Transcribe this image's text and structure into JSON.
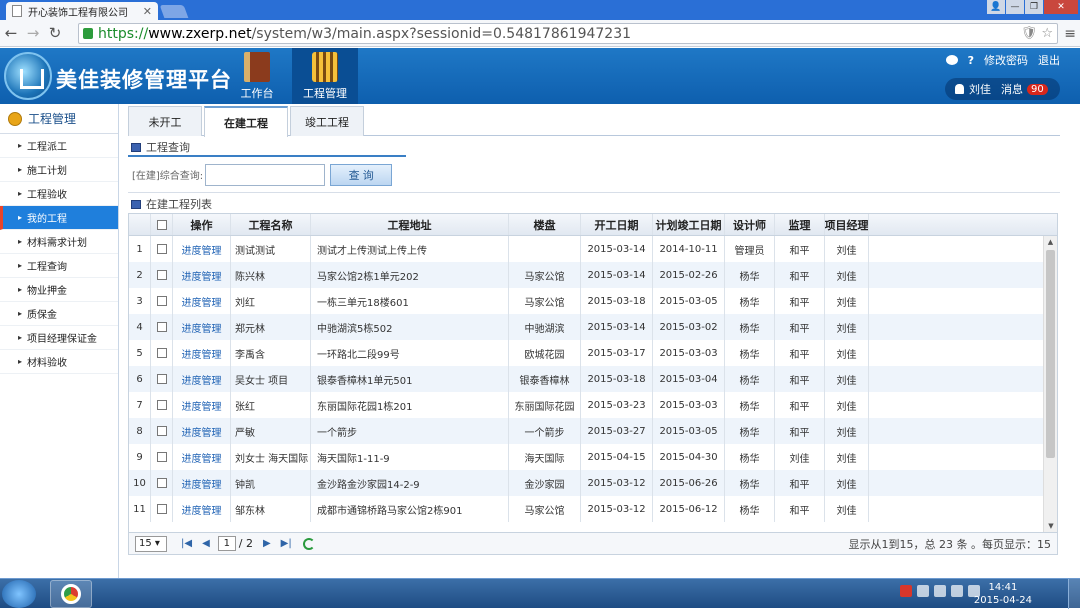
{
  "browser": {
    "tab_title": "开心装饰工程有限公司",
    "url_scheme": "https://",
    "url_host": "www.zxerp.net",
    "url_path": "/system/w3/main.aspx?sessionid=0.54817861947231"
  },
  "header": {
    "app_title": "美佳装修管理平台",
    "modules": [
      {
        "label": "工作台"
      },
      {
        "label": "工程管理"
      }
    ],
    "change_password": "修改密码",
    "logout": "退出",
    "user_name": "刘佳",
    "messages_label": "消息",
    "messages_count": "90"
  },
  "sidebar": {
    "title": "工程管理",
    "items": [
      {
        "label": "工程派工"
      },
      {
        "label": "施工计划"
      },
      {
        "label": "工程验收"
      },
      {
        "label": "我的工程"
      },
      {
        "label": "材料需求计划"
      },
      {
        "label": "工程查询"
      },
      {
        "label": "物业押金"
      },
      {
        "label": "质保金"
      },
      {
        "label": "项目经理保证金"
      },
      {
        "label": "材料验收"
      }
    ]
  },
  "tabs": [
    {
      "label": "未开工"
    },
    {
      "label": "在建工程"
    },
    {
      "label": "竣工工程"
    }
  ],
  "query": {
    "section_title": "工程查询",
    "label": "[在建]综合查询:",
    "value": "",
    "button": "查 询"
  },
  "list": {
    "section_title": "在建工程列表",
    "columns": [
      "操作",
      "工程名称",
      "工程地址",
      "楼盘",
      "开工日期",
      "计划竣工日期",
      "设计师",
      "监理",
      "项目经理"
    ],
    "rows": [
      {
        "no": "1",
        "op": "进度管理",
        "name": "测试测试",
        "addr": "测试才上传测试上传上传",
        "estate": "",
        "start": "2015-03-14",
        "end": "2014-10-11",
        "designer": "管理员",
        "supervisor": "和平",
        "manager": "刘佳"
      },
      {
        "no": "2",
        "op": "进度管理",
        "name": "陈兴林",
        "addr": "马家公馆2栋1单元202",
        "estate": "马家公馆",
        "start": "2015-03-14",
        "end": "2015-02-26",
        "designer": "杨华",
        "supervisor": "和平",
        "manager": "刘佳"
      },
      {
        "no": "3",
        "op": "进度管理",
        "name": "刘红",
        "addr": "一栋三单元18楼601",
        "estate": "马家公馆",
        "start": "2015-03-18",
        "end": "2015-03-05",
        "designer": "杨华",
        "supervisor": "和平",
        "manager": "刘佳"
      },
      {
        "no": "4",
        "op": "进度管理",
        "name": "郑元林",
        "addr": "中驰湖滨5栋502",
        "estate": "中驰湖滨",
        "start": "2015-03-14",
        "end": "2015-03-02",
        "designer": "杨华",
        "supervisor": "和平",
        "manager": "刘佳"
      },
      {
        "no": "5",
        "op": "进度管理",
        "name": "李禹含",
        "addr": "一环路北二段99号",
        "estate": "欧城花园",
        "start": "2015-03-17",
        "end": "2015-03-03",
        "designer": "杨华",
        "supervisor": "和平",
        "manager": "刘佳"
      },
      {
        "no": "6",
        "op": "进度管理",
        "name": "吴女士 项目",
        "addr": "银泰香樟林1单元501",
        "estate": "银泰香樟林",
        "start": "2015-03-18",
        "end": "2015-03-04",
        "designer": "杨华",
        "supervisor": "和平",
        "manager": "刘佳"
      },
      {
        "no": "7",
        "op": "进度管理",
        "name": "张红",
        "addr": "东丽国际花园1栋201",
        "estate": "东丽国际花园",
        "start": "2015-03-23",
        "end": "2015-03-03",
        "designer": "杨华",
        "supervisor": "和平",
        "manager": "刘佳"
      },
      {
        "no": "8",
        "op": "进度管理",
        "name": "严敏",
        "addr": "一个箭步",
        "estate": "一个箭步",
        "start": "2015-03-27",
        "end": "2015-03-05",
        "designer": "杨华",
        "supervisor": "和平",
        "manager": "刘佳"
      },
      {
        "no": "9",
        "op": "进度管理",
        "name": "刘女士 海天国际",
        "addr": "海天国际1-11-9",
        "estate": "海天国际",
        "start": "2015-04-15",
        "end": "2015-04-30",
        "designer": "杨华",
        "supervisor": "刘佳",
        "manager": "刘佳"
      },
      {
        "no": "10",
        "op": "进度管理",
        "name": "钟凯",
        "addr": "金沙路金沙家园14-2-9",
        "estate": "金沙家园",
        "start": "2015-03-12",
        "end": "2015-06-26",
        "designer": "杨华",
        "supervisor": "和平",
        "manager": "刘佳"
      },
      {
        "no": "11",
        "op": "进度管理",
        "name": "邹东林",
        "addr": "成都市通锦桥路马家公馆2栋901",
        "estate": "马家公馆",
        "start": "2015-03-12",
        "end": "2015-06-12",
        "designer": "杨华",
        "supervisor": "和平",
        "manager": "刘佳"
      }
    ]
  },
  "pager": {
    "page_size": "15",
    "current_page": "1",
    "total_pages": "/ 2",
    "info": "显示从1到15，总 23 条 。每页显示：15"
  },
  "taskbar": {
    "time": "14:41",
    "date": "2015-04-24"
  },
  "colors": {
    "header_blue": "#1f78c6",
    "active_blue": "#1f7fdc",
    "link_blue": "#1f62b4",
    "badge_red": "#d8271c"
  }
}
